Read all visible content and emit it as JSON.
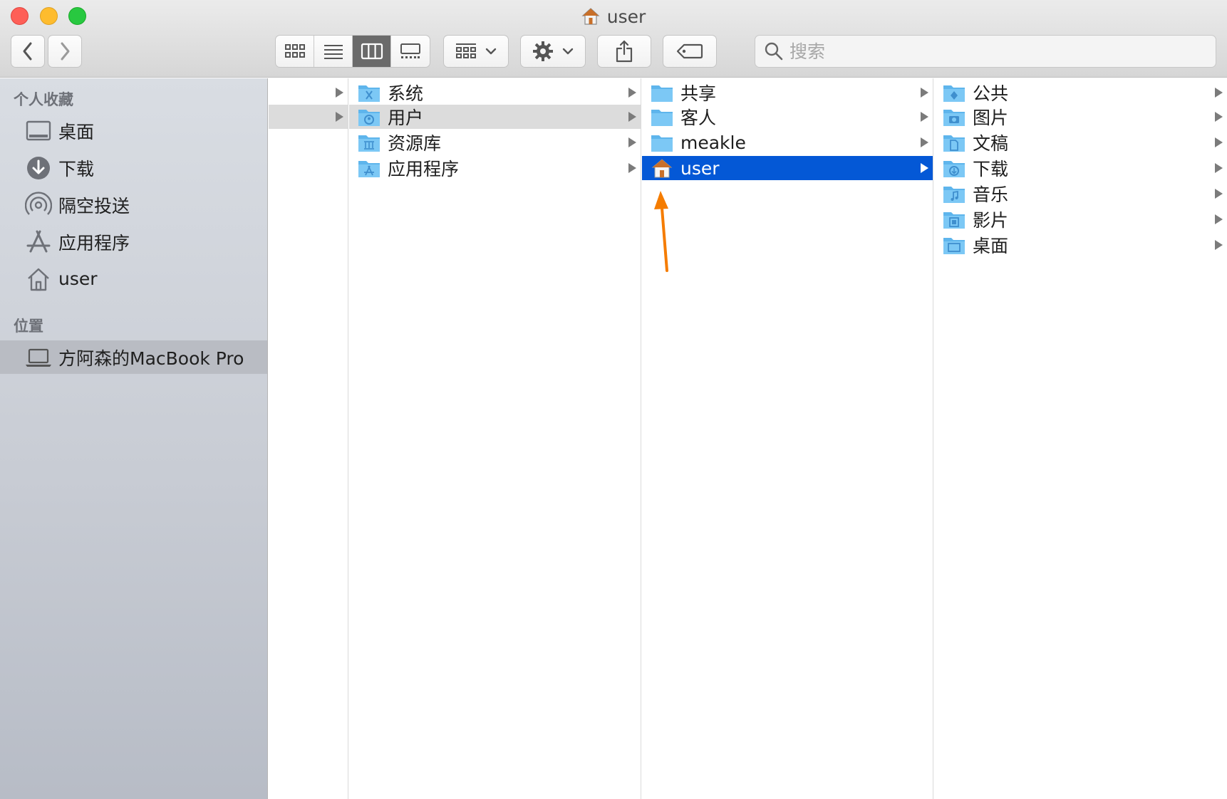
{
  "window": {
    "title": "user",
    "title_icon": "home-icon"
  },
  "toolbar": {
    "back_icon": "chevron-left-icon",
    "forward_icon": "chevron-right-icon",
    "view_modes": [
      "icon-view-icon",
      "list-view-icon",
      "column-view-icon",
      "gallery-view-icon"
    ],
    "active_view": "column",
    "group_icon": "group-by-icon",
    "action_icon": "gear-icon",
    "share_icon": "share-icon",
    "tag_icon": "tag-icon"
  },
  "search": {
    "placeholder": "搜索",
    "value": ""
  },
  "sidebar": {
    "favorites_header": "个人收藏",
    "favorites": [
      {
        "label": "桌面",
        "icon": "desktop-icon"
      },
      {
        "label": "下载",
        "icon": "download-icon"
      },
      {
        "label": "隔空投送",
        "icon": "airdrop-icon"
      },
      {
        "label": "应用程序",
        "icon": "applications-icon"
      },
      {
        "label": "user",
        "icon": "home-icon"
      }
    ],
    "locations_header": "位置",
    "locations": [
      {
        "label": "方阿森的MacBook Pro",
        "icon": "laptop-icon",
        "selected": true
      }
    ]
  },
  "columns": {
    "col2": [
      {
        "label": "系统",
        "icon": "system-folder-icon"
      },
      {
        "label": "用户",
        "icon": "users-folder-icon",
        "state": "parent"
      },
      {
        "label": "资源库",
        "icon": "library-folder-icon"
      },
      {
        "label": "应用程序",
        "icon": "applications-folder-icon"
      }
    ],
    "col3": [
      {
        "label": "共享",
        "icon": "folder-icon"
      },
      {
        "label": "客人",
        "icon": "folder-icon"
      },
      {
        "label": "meakle",
        "icon": "folder-icon"
      },
      {
        "label": "user",
        "icon": "home-icon",
        "state": "selected"
      }
    ],
    "col4": [
      {
        "label": "公共",
        "icon": "public-folder-icon"
      },
      {
        "label": "图片",
        "icon": "pictures-folder-icon"
      },
      {
        "label": "文稿",
        "icon": "documents-folder-icon"
      },
      {
        "label": "下载",
        "icon": "downloads-folder-icon"
      },
      {
        "label": "音乐",
        "icon": "music-folder-icon"
      },
      {
        "label": "影片",
        "icon": "movies-folder-icon"
      },
      {
        "label": "桌面",
        "icon": "desktop-folder-icon"
      }
    ]
  },
  "colors": {
    "selection": "#0458d6",
    "parent_highlight": "#dcdcdc",
    "folder": "#67bdf1",
    "annotation_arrow": "#f57c00"
  }
}
